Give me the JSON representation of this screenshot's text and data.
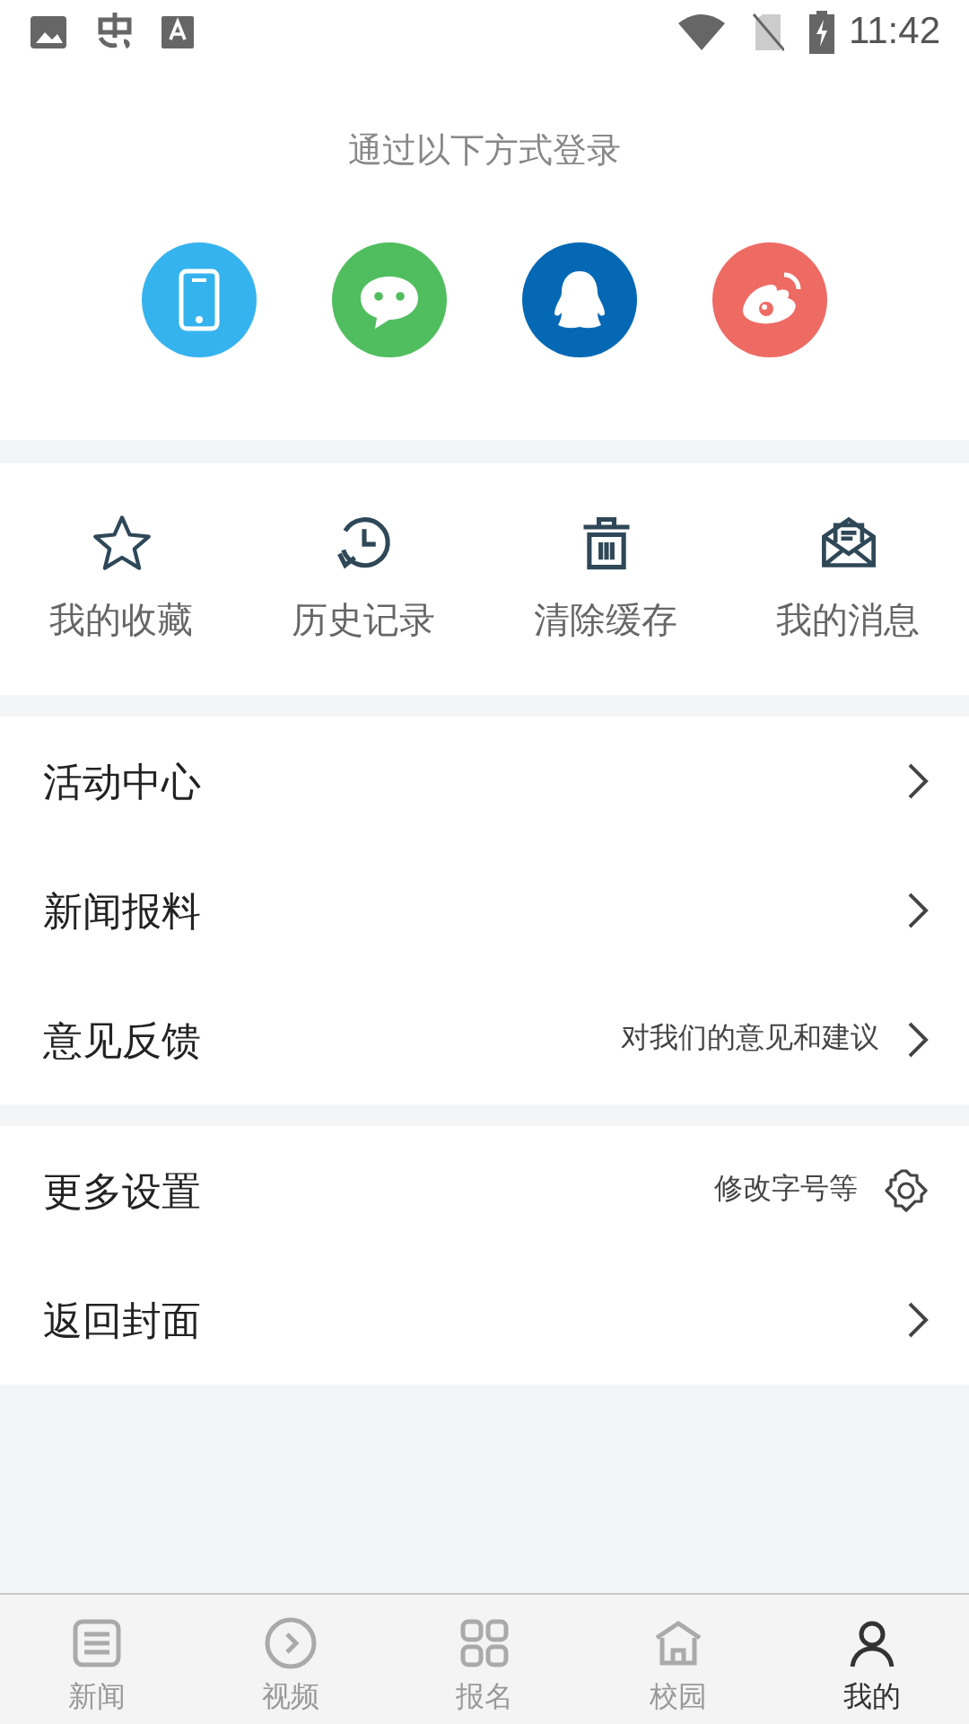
{
  "status_bar": {
    "time": "11:42"
  },
  "login": {
    "title": "通过以下方式登录",
    "methods": [
      {
        "kind": "phone",
        "color": "#35b3ee"
      },
      {
        "kind": "wechat",
        "color": "#50be5f"
      },
      {
        "kind": "qq",
        "color": "#0468b5"
      },
      {
        "kind": "weibo",
        "color": "#ee6b64"
      }
    ]
  },
  "shortcuts": [
    {
      "kind": "star",
      "label": "我的收藏"
    },
    {
      "kind": "history",
      "label": "历史记录"
    },
    {
      "kind": "trash",
      "label": "清除缓存"
    },
    {
      "kind": "mail",
      "label": "我的消息"
    }
  ],
  "menu_groups": [
    [
      {
        "label": "活动中心",
        "kind": "chevron"
      },
      {
        "label": "新闻报料",
        "kind": "chevron"
      },
      {
        "label": "意见反馈",
        "hint": "对我们的意见和建议",
        "kind": "chevron"
      }
    ],
    [
      {
        "label": "更多设置",
        "hint": "修改字号等",
        "kind": "gear"
      },
      {
        "label": "返回封面",
        "kind": "chevron"
      }
    ]
  ],
  "tab_bar": [
    {
      "kind": "news",
      "label": "新闻",
      "selected": false
    },
    {
      "kind": "video",
      "label": "视频",
      "selected": false
    },
    {
      "kind": "grid",
      "label": "报名",
      "selected": false
    },
    {
      "kind": "campus",
      "label": "校园",
      "selected": false
    },
    {
      "kind": "person",
      "label": "我的",
      "selected": true
    }
  ]
}
